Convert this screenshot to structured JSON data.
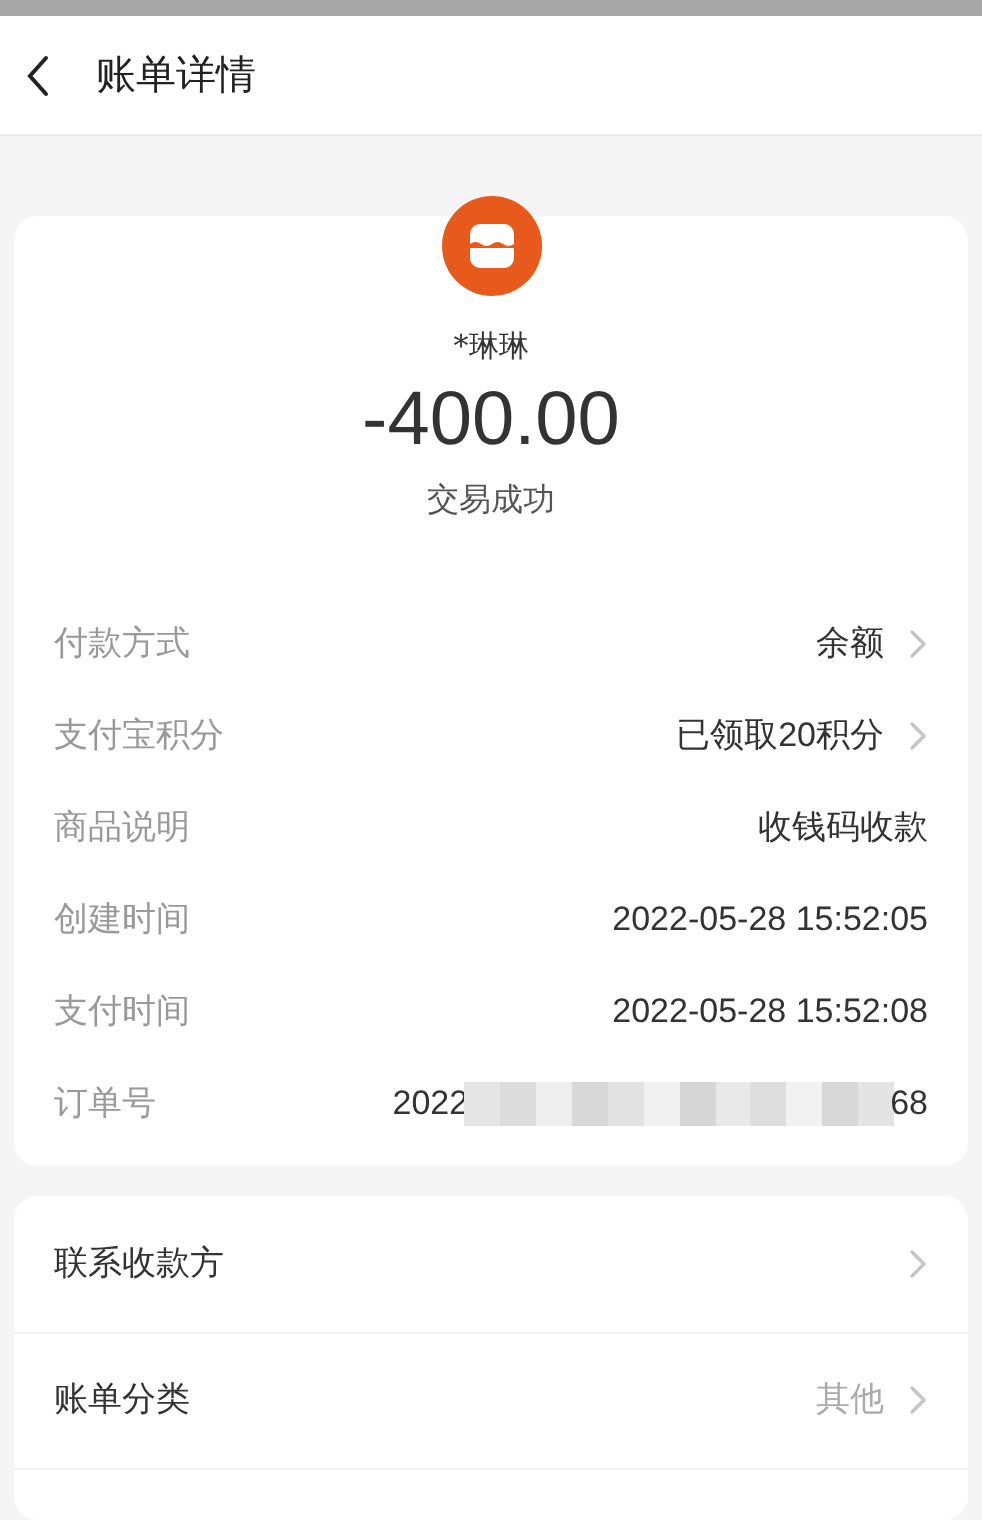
{
  "header": {
    "title": "账单详情"
  },
  "summary": {
    "payee": "*琳琳",
    "amount": "-400.00",
    "status": "交易成功"
  },
  "details": [
    {
      "kind": "text",
      "label": "付款方式",
      "value": "余额",
      "has_arrow": true
    },
    {
      "kind": "text",
      "label": "支付宝积分",
      "value": "已领取20积分",
      "has_arrow": true
    },
    {
      "kind": "text",
      "label": "商品说明",
      "value": "收钱码收款",
      "has_arrow": false
    },
    {
      "kind": "text",
      "label": "创建时间",
      "value": "2022-05-28 15:52:05",
      "has_arrow": false
    },
    {
      "kind": "text",
      "label": "支付时间",
      "value": "2022-05-28 15:52:08",
      "has_arrow": false
    },
    {
      "kind": "redacted",
      "label": "订单号",
      "value_start": "2022",
      "value_end": "68",
      "has_arrow": false
    }
  ],
  "actions": [
    {
      "label": "联系收款方",
      "has_arrow": true
    },
    {
      "label": "账单分类",
      "value": "其他",
      "has_arrow": true
    }
  ]
}
